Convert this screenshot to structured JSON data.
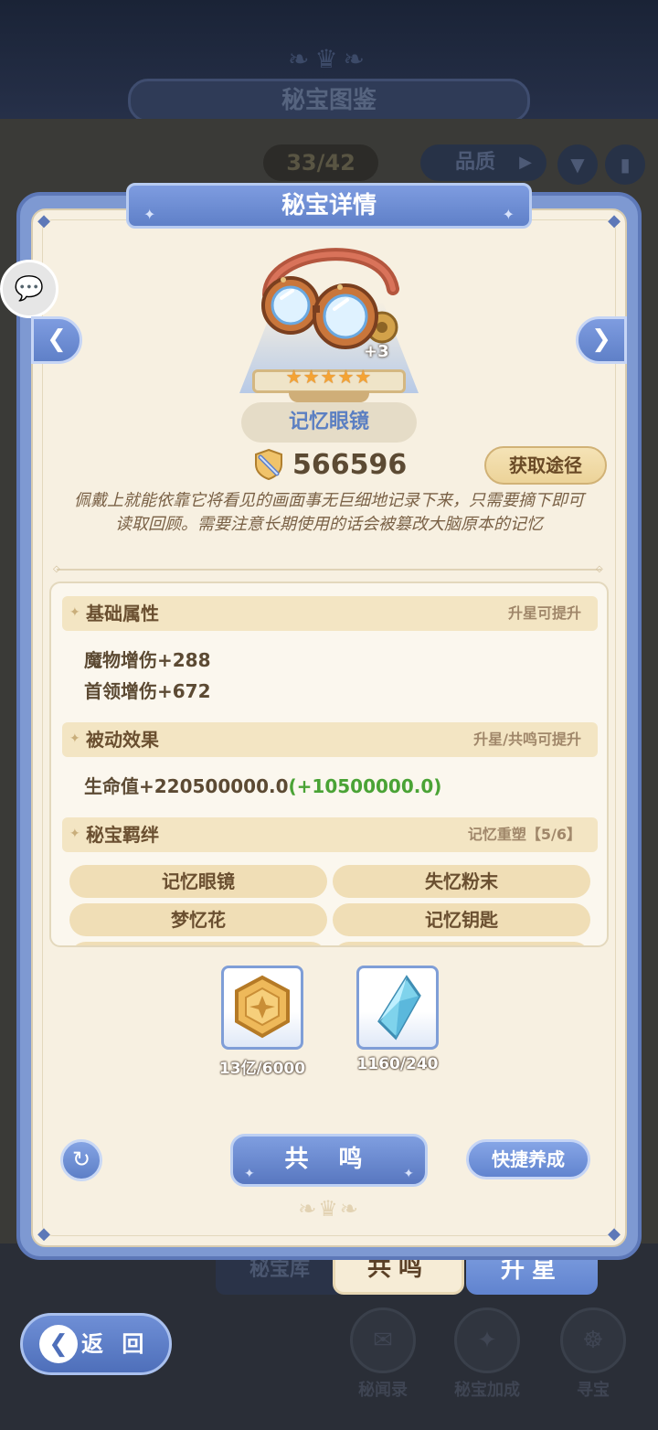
{
  "background": {
    "title": "秘宝图鉴",
    "count": "33/42",
    "quality_label": "品质",
    "tab_library": "秘宝库",
    "nav": [
      {
        "label": "秘闻录",
        "icon": "scroll-icon"
      },
      {
        "label": "秘宝加成",
        "icon": "sparkle-icon"
      },
      {
        "label": "寻宝",
        "icon": "compass-icon"
      }
    ]
  },
  "dialog": {
    "title": "秘宝详情",
    "item": {
      "name": "记忆眼镜",
      "plus_level": "+3",
      "stars": 5,
      "power": "566596",
      "source_button": "获取途径",
      "description": "佩戴上就能依靠它将看见的画面事无巨细地记录下来，只需要摘下即可读取回顾。需要注意长期使用的话会被篡改大脑原本的记忆"
    },
    "sections": {
      "base": {
        "title": "基础属性",
        "hint": "升星可提升",
        "stats": [
          "魔物增伤+288",
          "首领增伤+672"
        ]
      },
      "passive": {
        "title": "被动效果",
        "hint": "升星/共鸣可提升",
        "stat_main": "生命值+220500000.0",
        "stat_bonus": "(+10500000.0)"
      },
      "bond": {
        "title": "秘宝羁绊",
        "hint": "记忆重塑【5/6】",
        "items": [
          "记忆眼镜",
          "失忆粉末",
          "梦忆花",
          "记忆钥匙"
        ]
      }
    },
    "materials": [
      {
        "icon": "gold-coin-icon",
        "count": "13亿/6000"
      },
      {
        "icon": "blue-crystal-icon",
        "count": "1160/240"
      }
    ],
    "main_button": "共 鸣",
    "quick_button": "快捷养成"
  },
  "tabs": {
    "resonance": "共鸣",
    "upgrade": "升星"
  },
  "back_button": "返 回",
  "colors": {
    "accent_blue": "#5f80c8",
    "panel_cream": "#f7f0e1",
    "bonus_green": "#4aa335",
    "star_orange": "#f4a334",
    "alert_red": "#e54545"
  }
}
